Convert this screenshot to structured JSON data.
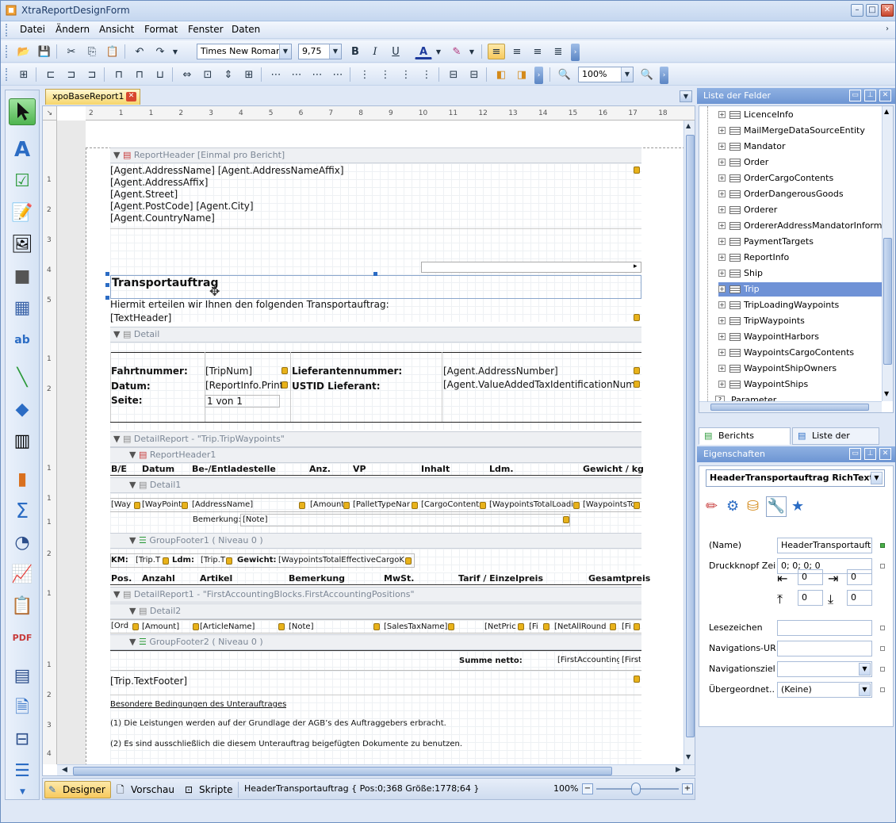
{
  "window": {
    "title": "XtraReportDesignForm"
  },
  "menu": [
    "Datei",
    "Ändern",
    "Ansicht",
    "Format",
    "Fenster",
    "Daten"
  ],
  "toolbar": {
    "font_name": "Times New Roman",
    "font_size": "9,75",
    "bold": "B",
    "italic": "I",
    "underline": "U",
    "font_color": "A",
    "zoom": "100%"
  },
  "document_tab": "xpoBaseReport1",
  "ruler": {
    "h_ticks": [
      "2",
      "1",
      "1",
      "2",
      "3",
      "4",
      "5",
      "6",
      "7",
      "8",
      "9",
      "10",
      "11",
      "12",
      "13",
      "14",
      "15",
      "16",
      "17",
      "18"
    ],
    "v_ticks": [
      "1",
      "2",
      "3",
      "4",
      "5",
      "1",
      "2",
      "1",
      "1",
      "1",
      "2",
      "1",
      "1",
      "2",
      "3",
      "4"
    ]
  },
  "report": {
    "band_report_header": "ReportHeader [Einmal pro Bericht]",
    "agent_lines": [
      "[Agent.AddressName] [Agent.AddressNameAffix]",
      "[Agent.AddressAffix]",
      "[Agent.Street]",
      "[Agent.PostCode] [Agent.City]",
      "[Agent.CountryName]"
    ],
    "title": "Transportauftrag",
    "intro": "Hiermit erteilen wir Ihnen den folgenden Transportauftrag:",
    "text_header": "[TextHeader]",
    "band_detail": "Detail",
    "fahrtnummer_label": "Fahrtnummer:",
    "fahrtnummer_value": "[TripNum]",
    "lieferant_label": "Lieferantennummer:",
    "lieferant_value": "[Agent.AddressNumber]",
    "datum_label": "Datum:",
    "datum_value": "[ReportInfo.Print",
    "ustid_label": "USTID Lieferant:",
    "ustid_value": "[Agent.ValueAddedTaxIdentificationNumb",
    "seite_label": "Seite:",
    "seite_value": "1 von 1",
    "band_detail_report_wp": "DetailReport - \"Trip.TripWaypoints\"",
    "band_report_header1": "ReportHeader1",
    "wp_headers": [
      "B/E",
      "Datum",
      "Be-/Entladestelle",
      "Anz.",
      "VP",
      "Inhalt",
      "Ldm.",
      "Gewicht / kg"
    ],
    "band_detail1": "Detail1",
    "wp_cells": [
      "[Way",
      "[WayPoint",
      "[AddressName]",
      "[Amount",
      "[PalletTypeNar",
      "[CargoContents",
      "[WaypointsTotalLoadi",
      "[WaypointsTo"
    ],
    "bemerkung_label": "Bemerkung:",
    "bemerkung_value": "[Note]",
    "band_group_footer1": "GroupFooter1 ( Niveau 0 )",
    "km_label": "KM:",
    "km_value": "[Trip.T",
    "ldm_label": "Ldm:",
    "ldm_value": "[Trip.T",
    "gewicht_label": "Gewicht:",
    "gewicht_value": "[WaypointsTotalEffectiveCargoK",
    "acc_headers": [
      "Pos.",
      "Anzahl",
      "Artikel",
      "Bemerkung",
      "MwSt.",
      "Tarif / Einzelpreis",
      "Gesamtpreis"
    ],
    "band_detail_report_acc": "DetailReport1 - \"FirstAccountingBlocks.FirstAccountingPositions\"",
    "band_detail2": "Detail2",
    "acc_cells": [
      "[Ord",
      "[Amount]",
      "[ArticleName]",
      "[Note]",
      "[SalesTaxName]",
      "[NetPric",
      "[Fi",
      "[NetAllRound",
      "[Fi"
    ],
    "band_group_footer2": "GroupFooter2 ( Niveau 0 )",
    "summe_label": "Summe netto:",
    "summe_value": "[FirstAccounting",
    "summe_value2": "[First",
    "text_footer": "[Trip.TextFooter]",
    "cond_title": "Besondere Bedingungen des Unterauftrages",
    "cond1": "(1) Die Leistungen werden auf der Grundlage der AGB’s des Auftraggebers erbracht.",
    "cond2": "(2) Es sind ausschließlich die diesem Unterauftrag beigefügten Dokumente zu benutzen."
  },
  "statusbar": {
    "designer": "Designer",
    "vorschau": "Vorschau",
    "skripte": "Skripte",
    "info": "HeaderTransportauftrag { Pos:0;368 Größe:1778;64 }",
    "zoom": "100%"
  },
  "fieldlist": {
    "title": "Liste der Felder",
    "items": [
      "LicenceInfo",
      "MailMergeDataSourceEntity",
      "Mandator",
      "Order",
      "OrderCargoContents",
      "OrderDangerousGoods",
      "Orderer",
      "OrdererAddressMandatorInformation",
      "PaymentTargets",
      "ReportInfo",
      "Ship",
      "Trip",
      "TripLoadingWaypoints",
      "TripWaypoints",
      "WaypointHarbors",
      "WaypointsCargoContents",
      "WaypointShipOwners",
      "WaypointShips"
    ],
    "selected_index": 11,
    "parameter": "Parameter",
    "tab_explorer": "Berichts Explorer",
    "tab_fields": "Liste der Felder"
  },
  "properties": {
    "title": "Eigenschaften",
    "object": "HeaderTransportauftrag  RichText",
    "rows": [
      {
        "label": "(Name)",
        "value": "HeaderTransportauft..."
      },
      {
        "label": "Druckknopf Zei...",
        "value": "0; 0; 0; 0"
      },
      {
        "label": "Lesezeichen",
        "value": ""
      },
      {
        "label": "Navigations-URL",
        "value": ""
      },
      {
        "label": "Navigationsziel",
        "value": ""
      },
      {
        "label": "Übergeordnet...",
        "value": "(Keine)"
      }
    ],
    "padding": [
      "0",
      "0",
      "0",
      "0"
    ]
  },
  "colors": {
    "accent": "#6d95d3",
    "selection": "#6f92d6",
    "active_tool": "#4fb44f"
  }
}
